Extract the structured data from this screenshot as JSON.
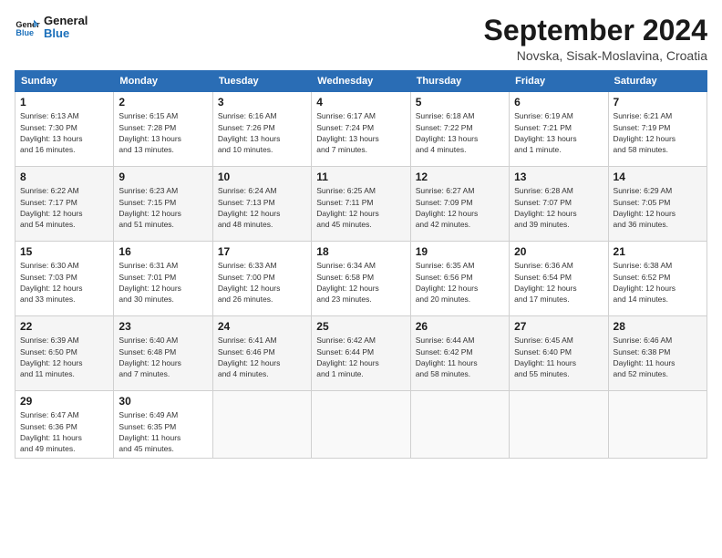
{
  "header": {
    "logo_line1": "General",
    "logo_line2": "Blue",
    "month": "September 2024",
    "location": "Novska, Sisak-Moslavina, Croatia"
  },
  "days_of_week": [
    "Sunday",
    "Monday",
    "Tuesday",
    "Wednesday",
    "Thursday",
    "Friday",
    "Saturday"
  ],
  "weeks": [
    [
      {
        "day": "1",
        "info": "Sunrise: 6:13 AM\nSunset: 7:30 PM\nDaylight: 13 hours\nand 16 minutes."
      },
      {
        "day": "2",
        "info": "Sunrise: 6:15 AM\nSunset: 7:28 PM\nDaylight: 13 hours\nand 13 minutes."
      },
      {
        "day": "3",
        "info": "Sunrise: 6:16 AM\nSunset: 7:26 PM\nDaylight: 13 hours\nand 10 minutes."
      },
      {
        "day": "4",
        "info": "Sunrise: 6:17 AM\nSunset: 7:24 PM\nDaylight: 13 hours\nand 7 minutes."
      },
      {
        "day": "5",
        "info": "Sunrise: 6:18 AM\nSunset: 7:22 PM\nDaylight: 13 hours\nand 4 minutes."
      },
      {
        "day": "6",
        "info": "Sunrise: 6:19 AM\nSunset: 7:21 PM\nDaylight: 13 hours\nand 1 minute."
      },
      {
        "day": "7",
        "info": "Sunrise: 6:21 AM\nSunset: 7:19 PM\nDaylight: 12 hours\nand 58 minutes."
      }
    ],
    [
      {
        "day": "8",
        "info": "Sunrise: 6:22 AM\nSunset: 7:17 PM\nDaylight: 12 hours\nand 54 minutes."
      },
      {
        "day": "9",
        "info": "Sunrise: 6:23 AM\nSunset: 7:15 PM\nDaylight: 12 hours\nand 51 minutes."
      },
      {
        "day": "10",
        "info": "Sunrise: 6:24 AM\nSunset: 7:13 PM\nDaylight: 12 hours\nand 48 minutes."
      },
      {
        "day": "11",
        "info": "Sunrise: 6:25 AM\nSunset: 7:11 PM\nDaylight: 12 hours\nand 45 minutes."
      },
      {
        "day": "12",
        "info": "Sunrise: 6:27 AM\nSunset: 7:09 PM\nDaylight: 12 hours\nand 42 minutes."
      },
      {
        "day": "13",
        "info": "Sunrise: 6:28 AM\nSunset: 7:07 PM\nDaylight: 12 hours\nand 39 minutes."
      },
      {
        "day": "14",
        "info": "Sunrise: 6:29 AM\nSunset: 7:05 PM\nDaylight: 12 hours\nand 36 minutes."
      }
    ],
    [
      {
        "day": "15",
        "info": "Sunrise: 6:30 AM\nSunset: 7:03 PM\nDaylight: 12 hours\nand 33 minutes."
      },
      {
        "day": "16",
        "info": "Sunrise: 6:31 AM\nSunset: 7:01 PM\nDaylight: 12 hours\nand 30 minutes."
      },
      {
        "day": "17",
        "info": "Sunrise: 6:33 AM\nSunset: 7:00 PM\nDaylight: 12 hours\nand 26 minutes."
      },
      {
        "day": "18",
        "info": "Sunrise: 6:34 AM\nSunset: 6:58 PM\nDaylight: 12 hours\nand 23 minutes."
      },
      {
        "day": "19",
        "info": "Sunrise: 6:35 AM\nSunset: 6:56 PM\nDaylight: 12 hours\nand 20 minutes."
      },
      {
        "day": "20",
        "info": "Sunrise: 6:36 AM\nSunset: 6:54 PM\nDaylight: 12 hours\nand 17 minutes."
      },
      {
        "day": "21",
        "info": "Sunrise: 6:38 AM\nSunset: 6:52 PM\nDaylight: 12 hours\nand 14 minutes."
      }
    ],
    [
      {
        "day": "22",
        "info": "Sunrise: 6:39 AM\nSunset: 6:50 PM\nDaylight: 12 hours\nand 11 minutes."
      },
      {
        "day": "23",
        "info": "Sunrise: 6:40 AM\nSunset: 6:48 PM\nDaylight: 12 hours\nand 7 minutes."
      },
      {
        "day": "24",
        "info": "Sunrise: 6:41 AM\nSunset: 6:46 PM\nDaylight: 12 hours\nand 4 minutes."
      },
      {
        "day": "25",
        "info": "Sunrise: 6:42 AM\nSunset: 6:44 PM\nDaylight: 12 hours\nand 1 minute."
      },
      {
        "day": "26",
        "info": "Sunrise: 6:44 AM\nSunset: 6:42 PM\nDaylight: 11 hours\nand 58 minutes."
      },
      {
        "day": "27",
        "info": "Sunrise: 6:45 AM\nSunset: 6:40 PM\nDaylight: 11 hours\nand 55 minutes."
      },
      {
        "day": "28",
        "info": "Sunrise: 6:46 AM\nSunset: 6:38 PM\nDaylight: 11 hours\nand 52 minutes."
      }
    ],
    [
      {
        "day": "29",
        "info": "Sunrise: 6:47 AM\nSunset: 6:36 PM\nDaylight: 11 hours\nand 49 minutes."
      },
      {
        "day": "30",
        "info": "Sunrise: 6:49 AM\nSunset: 6:35 PM\nDaylight: 11 hours\nand 45 minutes."
      },
      {
        "day": "",
        "info": ""
      },
      {
        "day": "",
        "info": ""
      },
      {
        "day": "",
        "info": ""
      },
      {
        "day": "",
        "info": ""
      },
      {
        "day": "",
        "info": ""
      }
    ]
  ]
}
